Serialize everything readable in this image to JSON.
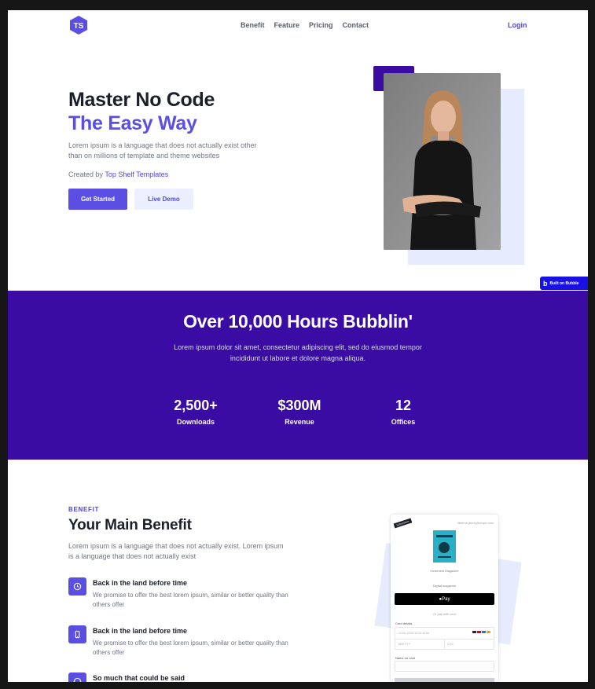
{
  "nav": {
    "logo_text": "TS",
    "links": [
      "Benefit",
      "Feature",
      "Pricing",
      "Contact"
    ],
    "login": "Login"
  },
  "hero": {
    "title_line1": "Master No Code",
    "title_line2": "The Easy Way",
    "description": "Lorem ipsum is a language that does not actually exist other than on millions of template and theme websites",
    "created_prefix": "Created by",
    "created_link": "Top Shelf Templates",
    "primary_button": "Get Started",
    "secondary_button": "Live Demo"
  },
  "bubble_badge": "Built on Bubble",
  "stats_band": {
    "title": "Over 10,000 Hours Bubblin'",
    "description": "Lorem ipsum dolor sit amet, consectetur adipiscing elit, sed do eiusmod tempor incididunt ut labore et dolore magna aliqua.",
    "stats": [
      {
        "value": "2,500+",
        "label": "Downloads"
      },
      {
        "value": "$300M",
        "label": "Revenue"
      },
      {
        "value": "12",
        "label": "Offices"
      }
    ]
  },
  "benefit": {
    "eyebrow": "BENEFIT",
    "title": "Your Main Benefit",
    "description": "Lorem ipsum is a language that does not actually exist. Lorem ipsum is a language that does not actually exist",
    "features": [
      {
        "icon": "clock-icon",
        "title": "Back in the land before time",
        "description": "We promise to offer the best lorem ipsum, similar or better quality than others offer"
      },
      {
        "icon": "phone-icon",
        "title": "Back in the land before time",
        "description": "We promise to offer the best lorem ipsum, similar or better quality than others offer"
      },
      {
        "icon": "chat-icon",
        "title": "So much that could be said",
        "description": ""
      }
    ]
  },
  "checkout": {
    "tag": "Subscription",
    "email": "lifetime.jenny@stripe.com",
    "product_name": "Increment Magazine",
    "product_sub": "Digital magazine",
    "pay_button": "Pay",
    "or_text": "Or pay with card",
    "card_label": "Card details",
    "card_placeholder": "1234 1234 1234 1234",
    "expiry_placeholder": "MM / YY",
    "cvc_placeholder": "CVC",
    "name_label": "Name on card"
  },
  "colors": {
    "brand": "#5b4fe3",
    "band": "#3a0ca3",
    "light_accent": "#e6ecfd"
  }
}
